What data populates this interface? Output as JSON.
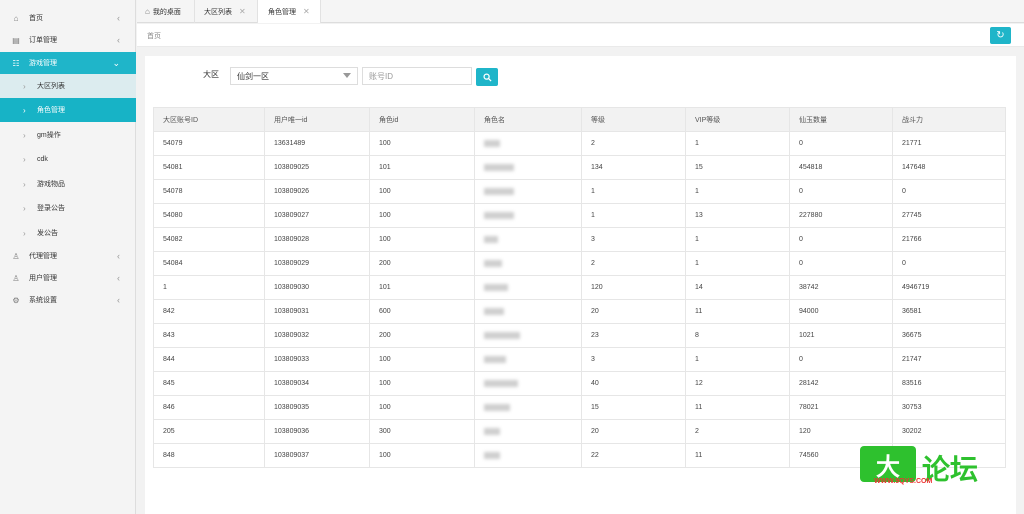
{
  "sidebar": {
    "items": [
      {
        "label": "首页",
        "icon": "home-icon"
      },
      {
        "label": "订单管理",
        "icon": "order-icon"
      },
      {
        "label": "游戏管理",
        "icon": "sitemap-icon"
      },
      {
        "label": "代理管理",
        "icon": "user-icon"
      },
      {
        "label": "用户管理",
        "icon": "user-icon"
      },
      {
        "label": "系统设置",
        "icon": "gear-icon"
      }
    ],
    "sub_items": [
      "大区列表",
      "角色管理",
      "gm操作",
      "cdk",
      "游戏物品",
      "登录公告",
      "发公告"
    ]
  },
  "tabs": [
    {
      "label": "我的桌面"
    },
    {
      "label": "大区列表"
    },
    {
      "label": "角色管理"
    }
  ],
  "breadcrumb": "首页",
  "filter": {
    "region_label": "大区",
    "region_selected": "仙剑一区",
    "account_placeholder": "账号ID"
  },
  "table": {
    "headers": [
      "大区账号ID",
      "用户唯一id",
      "角色id",
      "角色名",
      "等级",
      "VIP等级",
      "仙玉数量",
      "战斗力"
    ],
    "rows": [
      [
        "54079",
        "13631489",
        "100",
        "",
        "2",
        "1",
        "0",
        "21771"
      ],
      [
        "54081",
        "103809025",
        "101",
        "",
        "134",
        "15",
        "454818",
        "147648"
      ],
      [
        "54078",
        "103809026",
        "100",
        "",
        "1",
        "1",
        "0",
        "0"
      ],
      [
        "54080",
        "103809027",
        "100",
        "",
        "1",
        "13",
        "227880",
        "27745"
      ],
      [
        "54082",
        "103809028",
        "100",
        "",
        "3",
        "1",
        "0",
        "21766"
      ],
      [
        "54084",
        "103809029",
        "200",
        "",
        "2",
        "1",
        "0",
        "0"
      ],
      [
        "1",
        "103809030",
        "101",
        "",
        "120",
        "14",
        "38742",
        "4946719"
      ],
      [
        "842",
        "103809031",
        "600",
        "",
        "20",
        "11",
        "94000",
        "36581"
      ],
      [
        "843",
        "103809032",
        "200",
        "",
        "23",
        "8",
        "1021",
        "36675"
      ],
      [
        "844",
        "103809033",
        "100",
        "",
        "3",
        "1",
        "0",
        "21747"
      ],
      [
        "845",
        "103809034",
        "100",
        "",
        "40",
        "12",
        "28142",
        "83516"
      ],
      [
        "846",
        "103809035",
        "100",
        "",
        "15",
        "11",
        "78021",
        "30753"
      ],
      [
        "205",
        "103809036",
        "300",
        "",
        "20",
        "2",
        "120",
        "30202"
      ],
      [
        "848",
        "103809037",
        "100",
        "",
        "22",
        "11",
        "74560",
        ""
      ]
    ]
  },
  "watermark": {
    "big": "大",
    "text": "论坛",
    "url": "WWW.9QYS.COM"
  },
  "colors": {
    "accent": "#1fb5c9"
  }
}
